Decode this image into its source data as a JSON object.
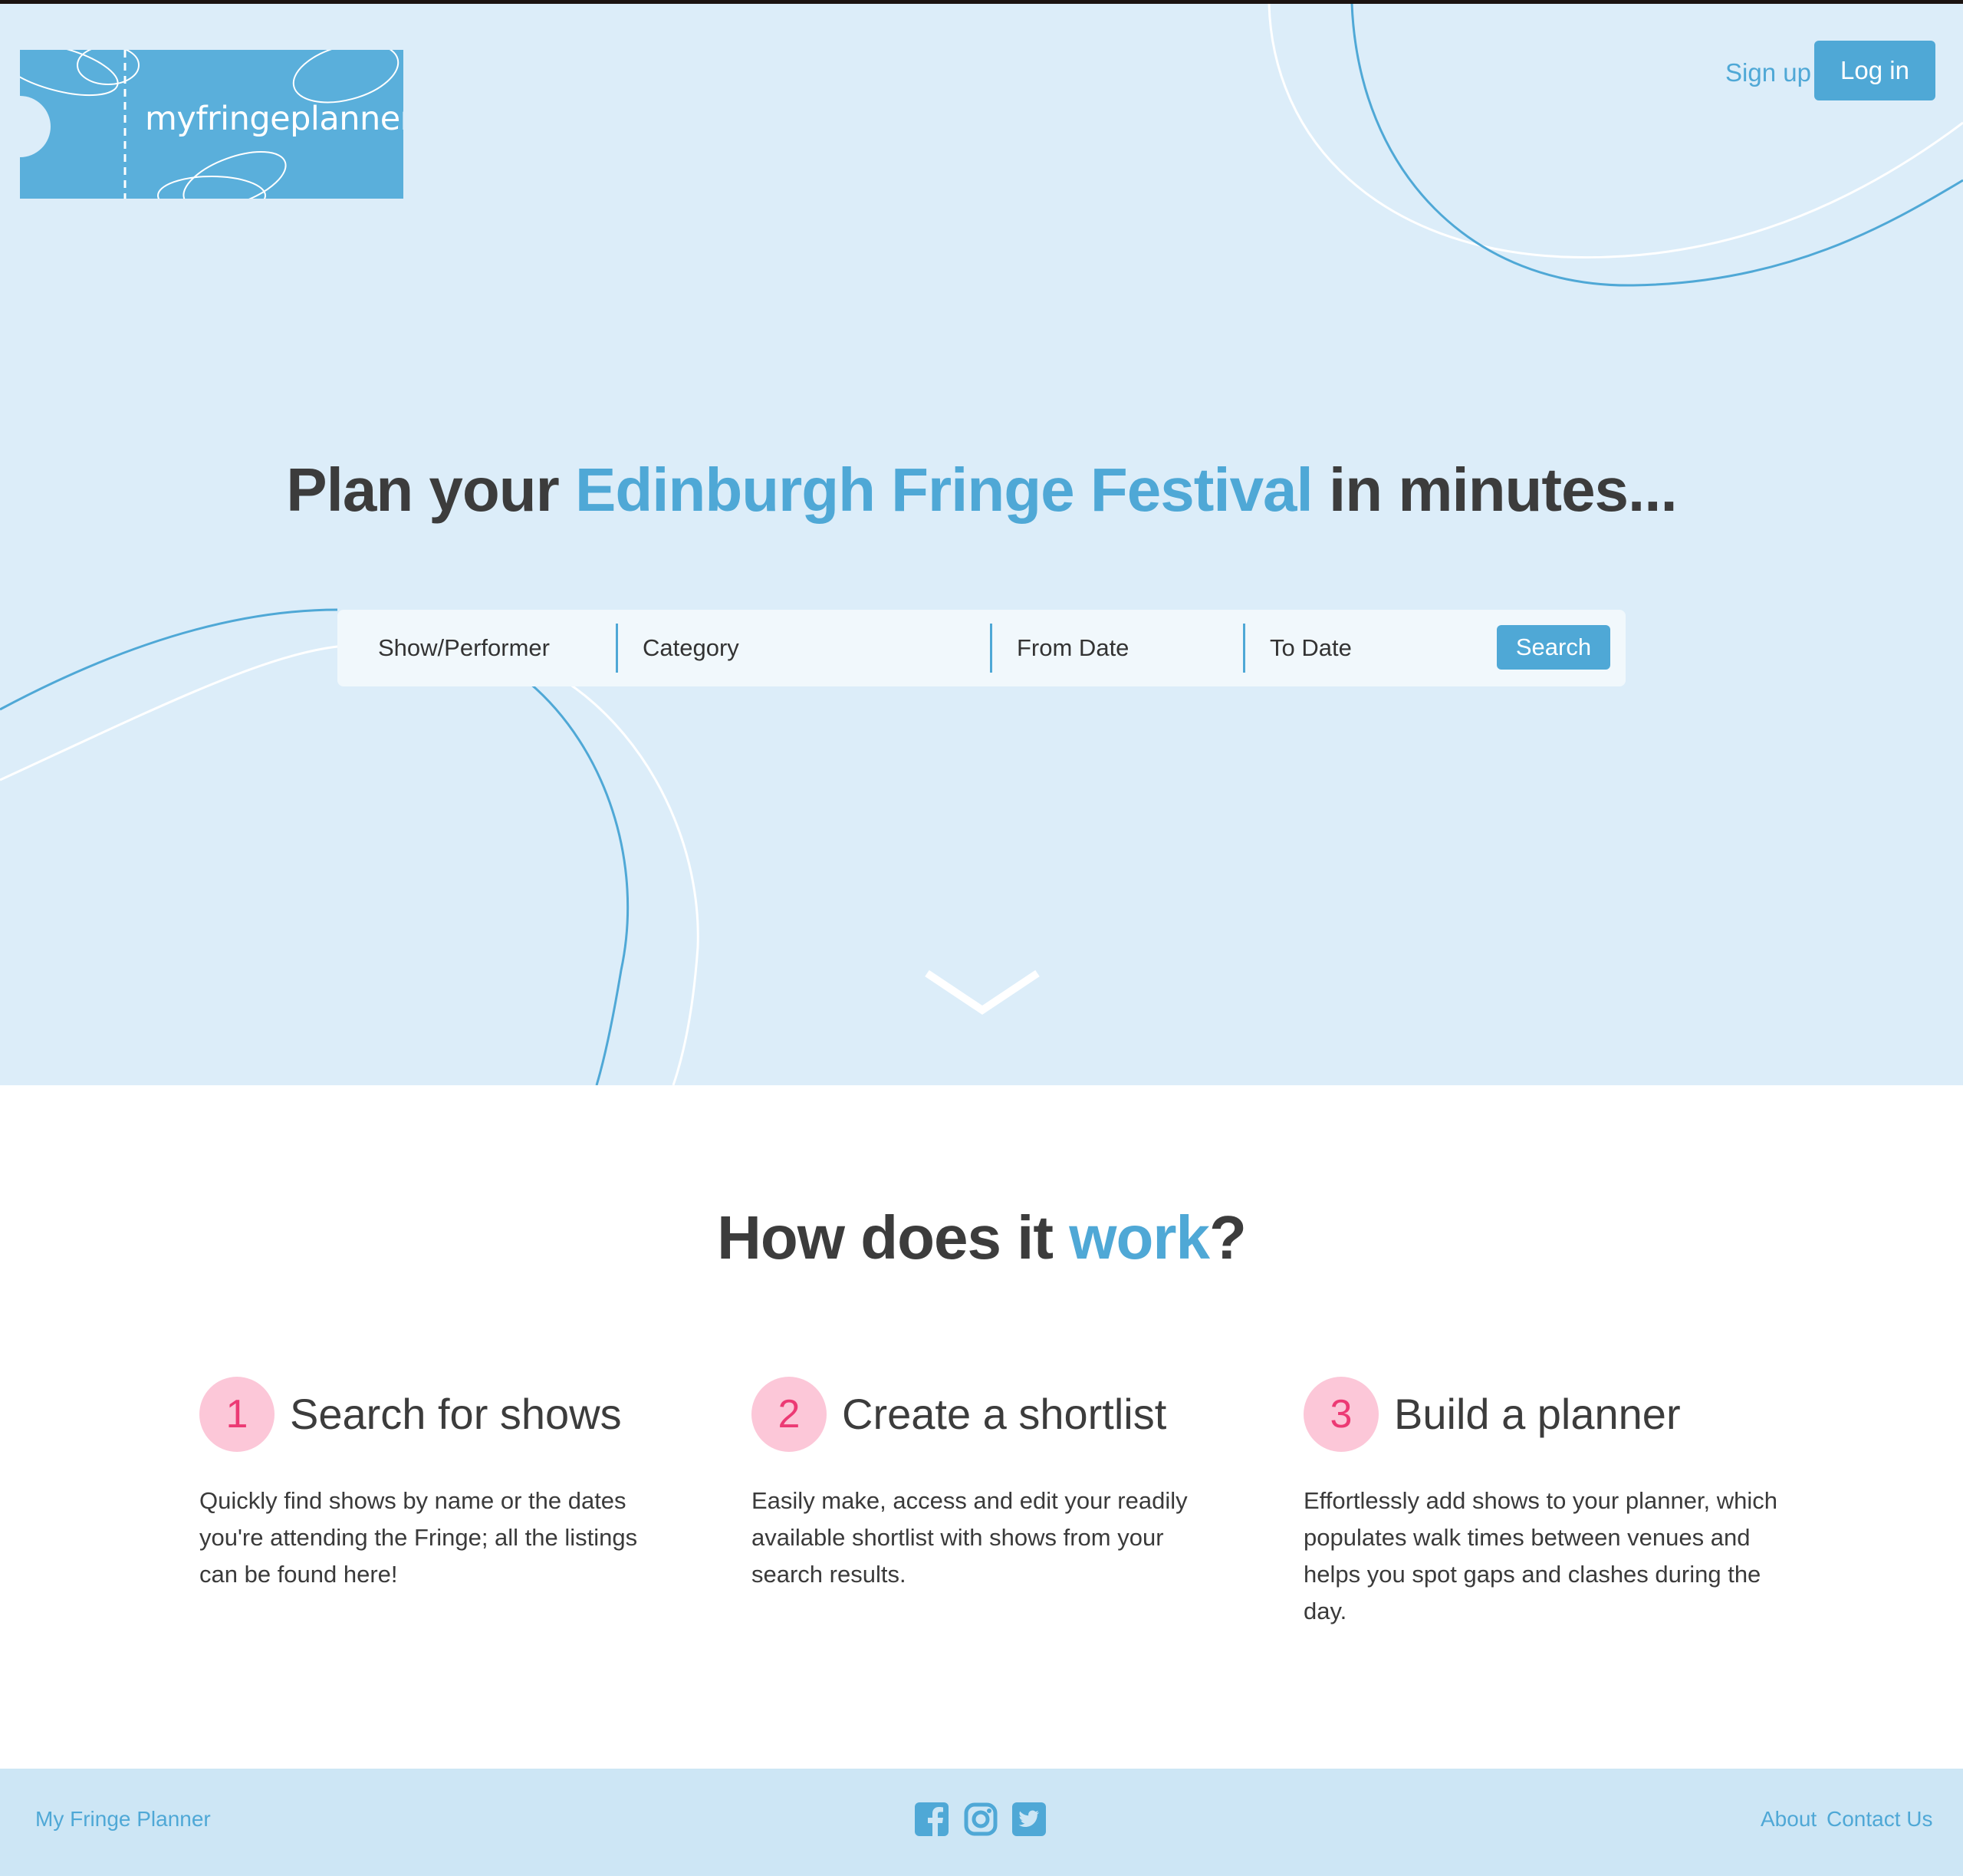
{
  "header": {
    "logo_text": "myfringeplanner",
    "signup_label": "Sign up",
    "login_label": "Log in"
  },
  "hero": {
    "headline_prefix": "Plan your ",
    "headline_accent": "Edinburgh Fringe Festival",
    "headline_suffix": " in minutes..."
  },
  "search": {
    "show_performer": "Show/Performer",
    "category": "Category",
    "from_date": "From Date",
    "to_date": "To Date",
    "button_label": "Search"
  },
  "how": {
    "title_prefix": "How does it ",
    "title_accent": "work",
    "title_suffix": "?",
    "steps": [
      {
        "number": "1",
        "title": "Search for shows",
        "description": "Quickly find shows by name or the dates you're attending the Fringe; all the listings can be found here!"
      },
      {
        "number": "2",
        "title": "Create a shortlist",
        "description": "Easily make, access and edit your readily available shortlist with shows from your search results."
      },
      {
        "number": "3",
        "title": "Build a planner",
        "description": "Effortlessly add shows to your planner, which populates walk times between venues and helps you spot gaps and clashes during the day."
      }
    ]
  },
  "footer": {
    "brand": "My Fringe Planner",
    "about": "About",
    "contact": "Contact Us",
    "social_icons": [
      "facebook-icon",
      "instagram-icon",
      "twitter-icon"
    ]
  },
  "colors": {
    "hero_background": "#dcedf9",
    "accent_blue": "#4fa8d6",
    "step_circle": "#fcc7d8",
    "step_number": "#ec3a74",
    "footer_background": "#cde6f5"
  }
}
